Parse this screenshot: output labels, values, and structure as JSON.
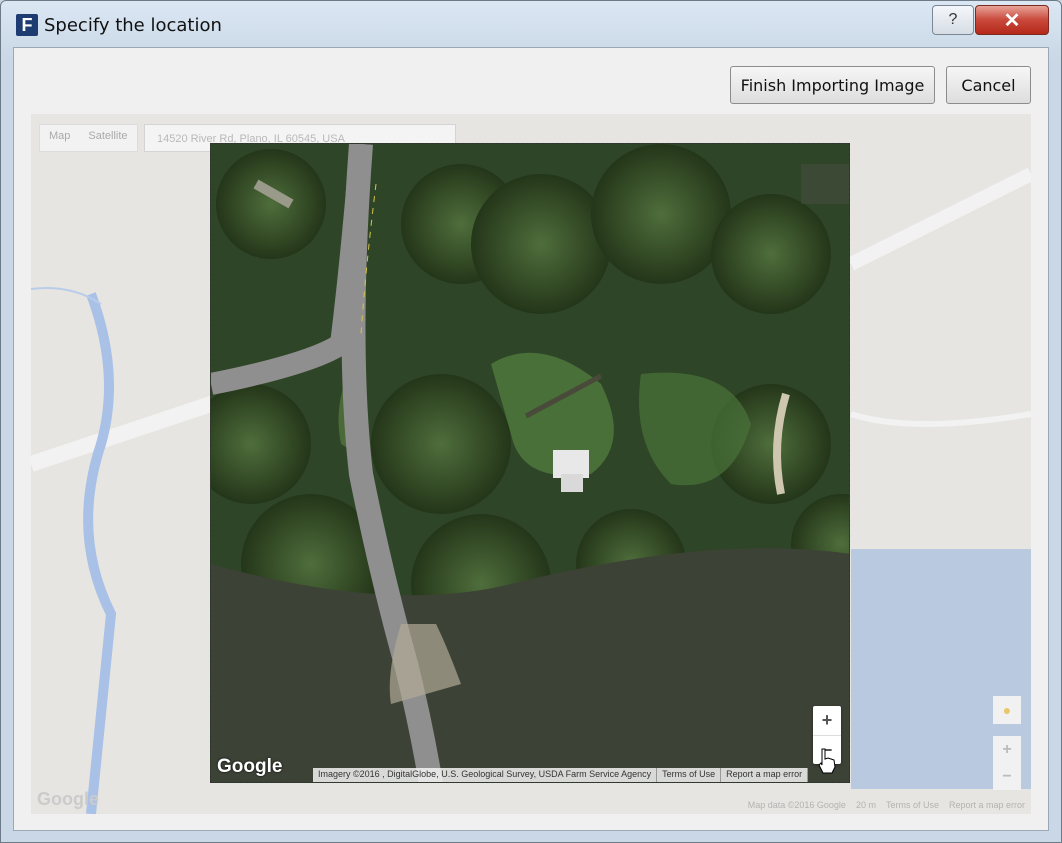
{
  "window": {
    "title": "Specify the location",
    "app_icon_letter": "F",
    "help_glyph": "?",
    "close_glyph": "✕"
  },
  "toolbar": {
    "finish_label": "Finish Importing Image",
    "cancel_label": "Cancel"
  },
  "map": {
    "tabs": [
      "Map",
      "Satellite"
    ],
    "address": "14520 River Rd, Plano, IL 60545, USA",
    "watermark": "© 2016 Google",
    "logo": "Google",
    "imagery_attribution": "Imagery ©2016 , DigitalGlobe, U.S. Geological Survey, USDA Farm Service Agency",
    "terms": "Terms of Use",
    "report": "Report a map error",
    "zoom_in": "+",
    "zoom_out": "−",
    "outer_map_data": "Map data ©2016 Google",
    "outer_scale": "20 m",
    "outer_terms": "Terms of Use",
    "outer_report": "Report a map error",
    "outer_logo": "Google"
  },
  "colors": {
    "close_red": "#c8483a",
    "water": "#3d4236",
    "forest": "#2e4227"
  }
}
